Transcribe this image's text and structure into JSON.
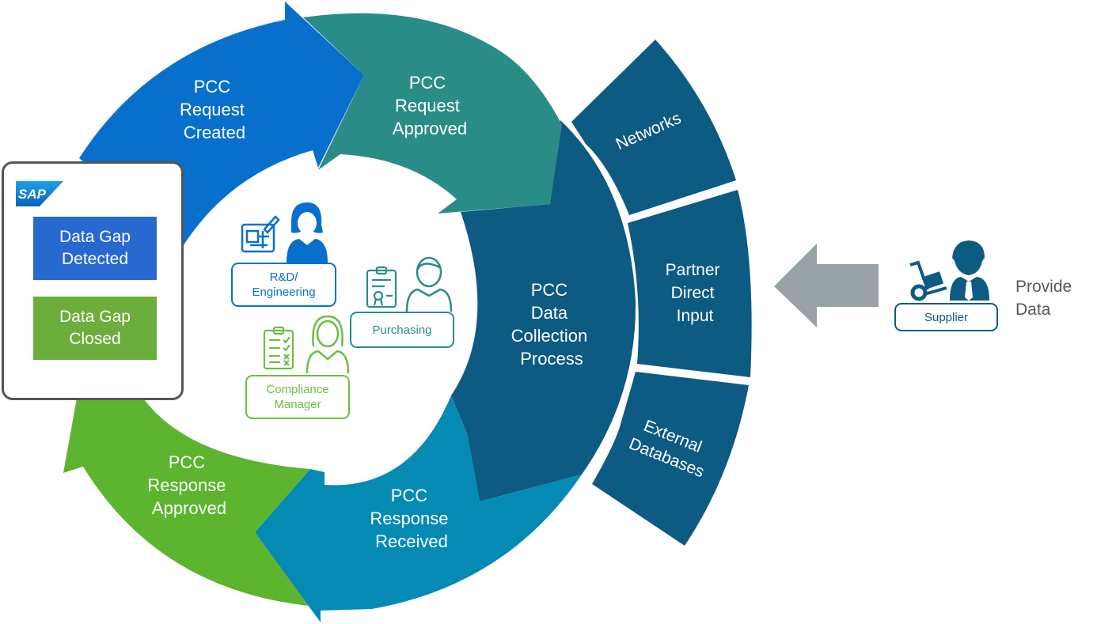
{
  "colors": {
    "request_created": "#0870cc",
    "request_approved": "#2a8c86",
    "data_collection": "#0d5a82",
    "response_received": "#058ab4",
    "response_approved": "#5db42f",
    "sources": "#0d5a82",
    "arrow_gray": "#97a1a6",
    "rd_blue": "#0870cc",
    "purchasing_teal": "#2a8c86",
    "compliance_green": "#6cbe45"
  },
  "cycle": {
    "request_created": [
      "PCC",
      "Request",
      "Created"
    ],
    "request_approved": [
      "PCC",
      "Request",
      "Approved"
    ],
    "data_collection": [
      "PCC",
      "Data",
      "Collection",
      "Process"
    ],
    "response_received": [
      "PCC",
      "Response",
      "Received"
    ],
    "response_approved": [
      "PCC",
      "Response",
      "Approved"
    ]
  },
  "sources": {
    "networks": [
      "Networks"
    ],
    "partner_direct_input": [
      "Partner",
      "Direct",
      "Input"
    ],
    "external_databases": [
      "External",
      "Databases"
    ]
  },
  "sap_panel": {
    "logo_text": "SAP",
    "gap_detected": "Data Gap Detected",
    "gap_closed": "Data Gap Closed"
  },
  "roles": {
    "rd": "R&D/ Engineering",
    "purchasing": "Purchasing",
    "compliance": "Compliance Manager"
  },
  "supplier": {
    "label": "Supplier",
    "provide_line1": "Provide",
    "provide_line2": "Data"
  }
}
